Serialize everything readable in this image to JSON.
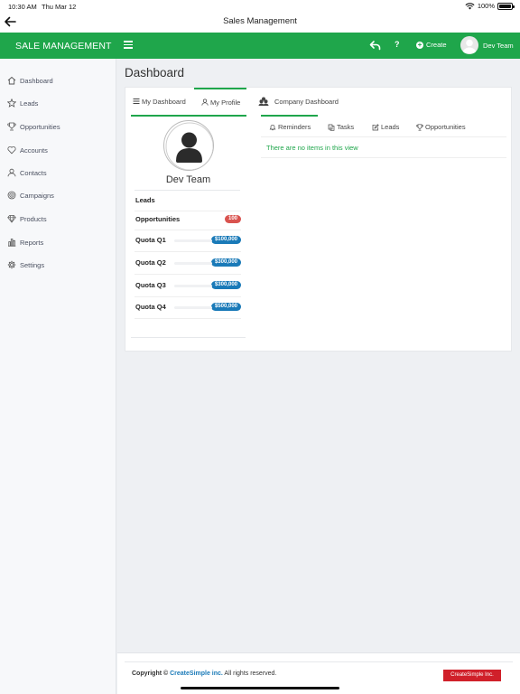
{
  "status_bar": {
    "time": "10:30 AM",
    "date": "Thu Mar 12",
    "battery": "100%",
    "battery_level": 1.0
  },
  "nav_bar": {
    "title": "Sales Management"
  },
  "header": {
    "brand": "SALE MANAGEMENT",
    "help": "?",
    "create_label": "Create",
    "user_name": "Dev Team"
  },
  "sidebar": {
    "items": [
      {
        "label": "Dashboard",
        "icon": "home-icon"
      },
      {
        "label": "Leads",
        "icon": "star-icon"
      },
      {
        "label": "Opportunities",
        "icon": "trophy-icon"
      },
      {
        "label": "Accounts",
        "icon": "heart-icon"
      },
      {
        "label": "Contacts",
        "icon": "user-icon"
      },
      {
        "label": "Campaigns",
        "icon": "target-icon"
      },
      {
        "label": "Products",
        "icon": "diamond-icon"
      },
      {
        "label": "Reports",
        "icon": "bar-chart-icon"
      },
      {
        "label": "Settings",
        "icon": "gear-icon"
      }
    ]
  },
  "page": {
    "title": "Dashboard"
  },
  "tabs": [
    {
      "label": "My Dashboard",
      "icon": "list-icon"
    },
    {
      "label": "My Profile",
      "icon": "user-icon",
      "active": true
    },
    {
      "label": "Company Dashboard",
      "icon": "users-icon"
    }
  ],
  "profile": {
    "name": "Dev Team",
    "leads_label": "Leads",
    "opportunities_label": "Opportunities",
    "opportunities_count": "100",
    "quotas": [
      {
        "label": "Quota Q1",
        "value": "$100,000"
      },
      {
        "label": "Quota Q2",
        "value": "$300,000"
      },
      {
        "label": "Quota Q3",
        "value": "$300,000"
      },
      {
        "label": "Quota Q4",
        "value": "$500,000"
      }
    ]
  },
  "subtabs": [
    {
      "label": "Reminders",
      "icon": "bell-icon",
      "active": true
    },
    {
      "label": "Tasks",
      "icon": "copy-icon"
    },
    {
      "label": "Leads",
      "icon": "edit-icon"
    },
    {
      "label": "Opportunities",
      "icon": "trophy-icon"
    }
  ],
  "empty_message": "There are no items in this view",
  "footer": {
    "copyright_prefix": "Copyright ©",
    "company": "CreateSimple inc.",
    "rights": "All rights reserved.",
    "button_label": "CreateSimple Inc."
  },
  "colors": {
    "accent": "#1fa64b",
    "badge_red": "#d9534f",
    "badge_blue": "#1a7ab8",
    "footer_button": "#d0202a"
  }
}
